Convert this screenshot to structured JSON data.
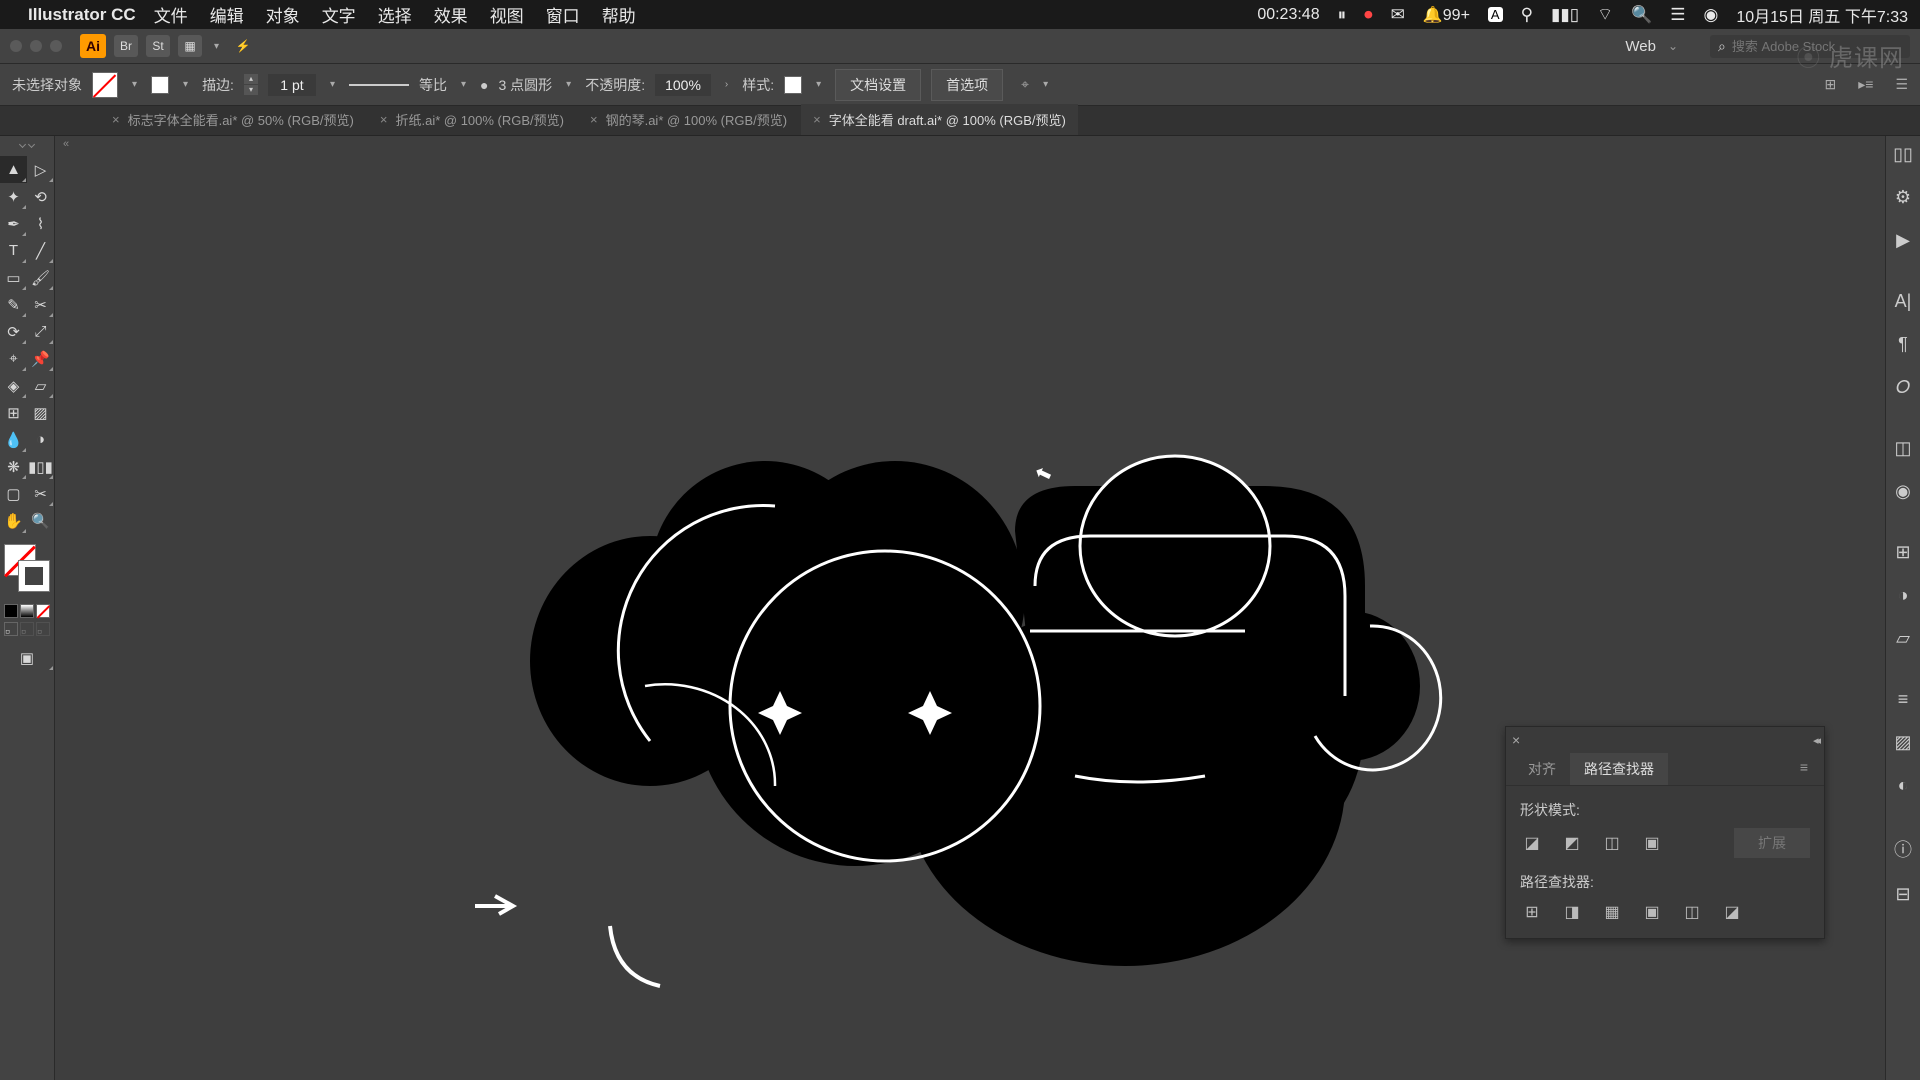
{
  "menubar": {
    "app": "Illustrator CC",
    "items": [
      "文件",
      "编辑",
      "对象",
      "文字",
      "选择",
      "效果",
      "视图",
      "窗口",
      "帮助"
    ],
    "timer": "00:23:48",
    "notif": "99+",
    "date": "10月15日 周五 下午7:33"
  },
  "appbar": {
    "mode": "Web",
    "search_placeholder": "搜索 Adobe Stock"
  },
  "control": {
    "selection": "未选择对象",
    "stroke_label": "描边:",
    "stroke_w": "1 pt",
    "profile": "等比",
    "brush_opt": "3 点圆形",
    "opacity_label": "不透明度:",
    "opacity": "100%",
    "style_label": "样式:",
    "doc_setup": "文档设置",
    "prefs": "首选项"
  },
  "tabs": [
    {
      "label": "标志字体全能看.ai* @ 50% (RGB/预览)",
      "active": false
    },
    {
      "label": "折纸.ai* @ 100% (RGB/预览)",
      "active": false
    },
    {
      "label": "钢的琴.ai* @ 100% (RGB/预览)",
      "active": false
    },
    {
      "label": "字体全能看 draft.ai* @ 100% (RGB/预览)",
      "active": true
    }
  ],
  "panel": {
    "tab_align": "对齐",
    "tab_pathfinder": "路径查找器",
    "shape_modes": "形状模式:",
    "pathfinders": "路径查找器:",
    "expand": "扩展"
  },
  "watermark": "虎课网"
}
